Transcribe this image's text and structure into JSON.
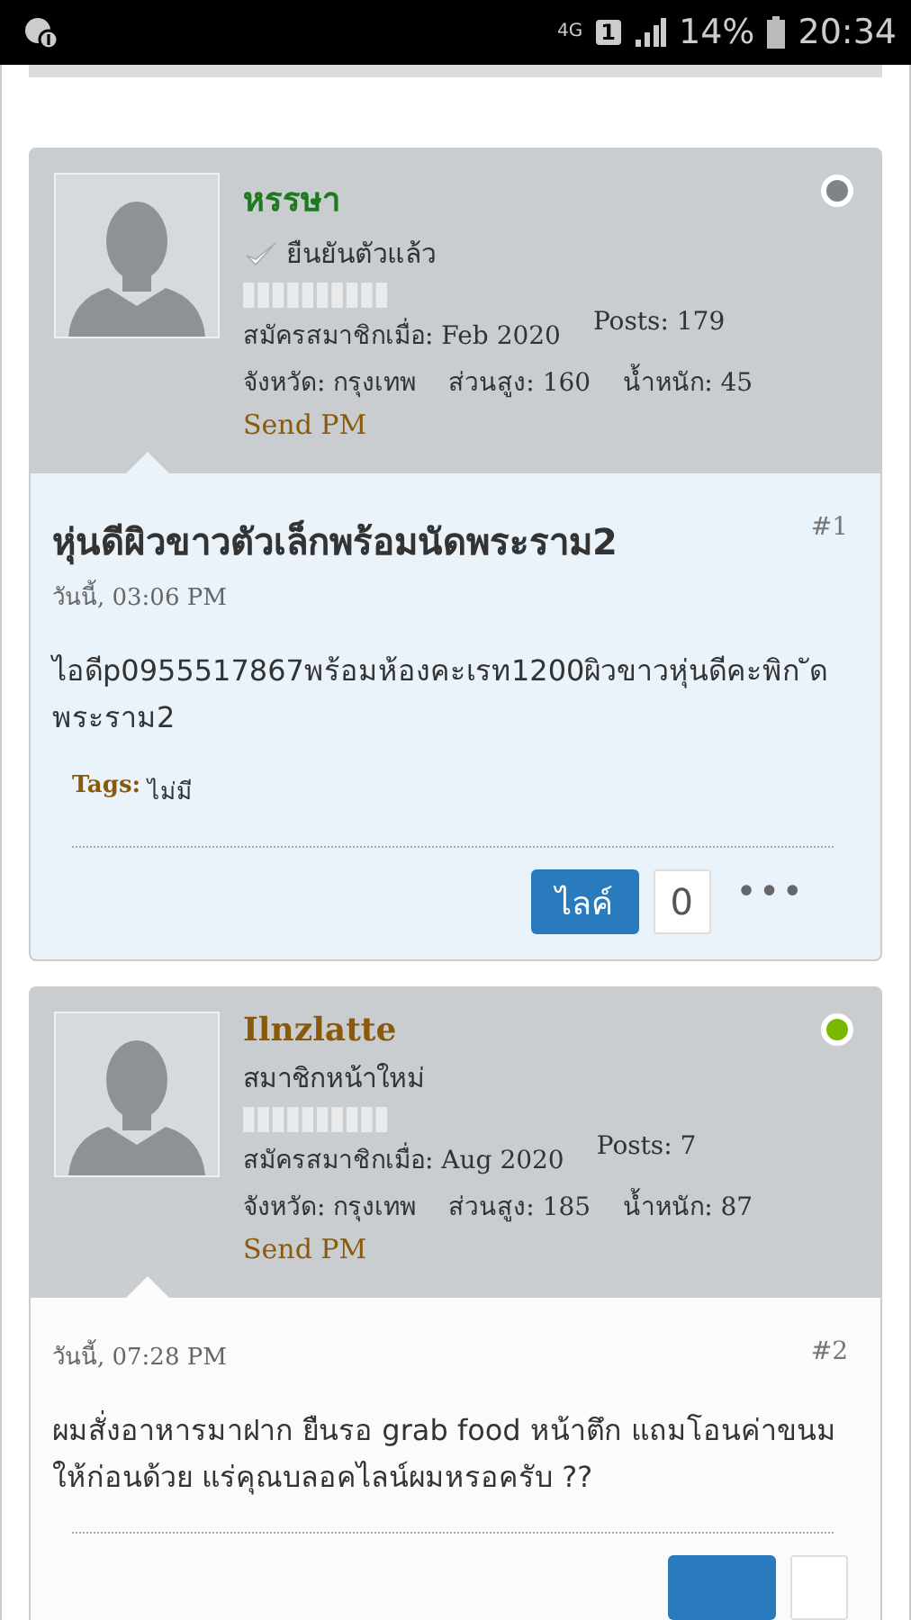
{
  "status_bar": {
    "network": "4G",
    "sim": "1",
    "battery": "14%",
    "time": "20:34"
  },
  "posts": [
    {
      "user": {
        "name": "หรรษา",
        "color": "#1e7a1e",
        "online": false,
        "verified": true,
        "title": "ยืนยันตัวแล้ว",
        "joined": "สมัครสมาชิกเมื่อ: Feb 2020",
        "posts": "Posts: 179",
        "province": "จังหวัด: กรุงเทพ",
        "height": "ส่วนสูง: 160",
        "weight": "น้ำหนัก: 45",
        "send_pm": "Send PM"
      },
      "highlighted": true,
      "title": "หุ่นดีผิวขาวตัวเล็กพร้อมนัดพระราม2",
      "date": "วันนี้, 03:06 PM",
      "number": "#1",
      "text": "ไอดีp0955517867พร้อมห้องคะเรท1200ผิวขาวหุ่นดีคะพิก ัด พระราม2",
      "tags_label": "Tags:",
      "tags": "ไม่มี",
      "like": "ไลค์",
      "like_count": "0",
      "more": "•••"
    },
    {
      "user": {
        "name": "Ilnzlatte",
        "color": "#8a5a0a",
        "online": true,
        "verified": false,
        "title": "สมาชิกหน้าใหม่",
        "joined": "สมัครสมาชิกเมื่อ: Aug 2020",
        "posts": "Posts: 7",
        "province": "จังหวัด: กรุงเทพ",
        "height": "ส่วนสูง: 185",
        "weight": "น้ำหนัก: 87",
        "send_pm": "Send PM"
      },
      "highlighted": false,
      "date": "วันนี้, 07:28 PM",
      "number": "#2",
      "text": "ผมสั่งอาหารมาฝาก ยืนรอ grab food หน้าตึก แถมโอนค่าขนมให้ก่อนด้วย แร่คุณบลอคไลน์ผมหรอครับ ??"
    }
  ]
}
